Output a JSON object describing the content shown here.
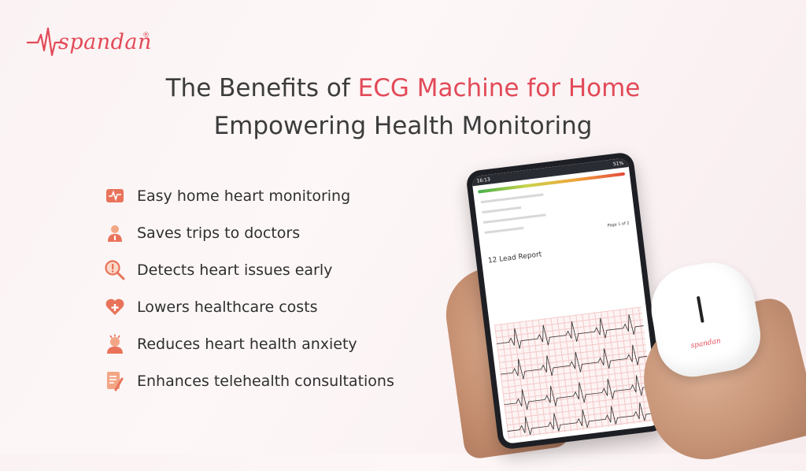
{
  "brand": {
    "name": "spandan",
    "registered": "®",
    "color": "#e24a58"
  },
  "heading": {
    "line1_prefix": "The Benefits of ",
    "line1_highlight": "ECG Machine for Home",
    "line2": "Empowering Health Monitoring"
  },
  "benefits": [
    {
      "label": "Easy home heart monitoring",
      "icon": "heart-monitor-icon"
    },
    {
      "label": "Saves trips to doctors",
      "icon": "doctor-icon"
    },
    {
      "label": "Detects heart issues early",
      "icon": "magnifier-icon"
    },
    {
      "label": "Lowers healthcare costs",
      "icon": "heart-plus-icon"
    },
    {
      "label": "Reduces heart health anxiety",
      "icon": "stress-person-icon"
    },
    {
      "label": "Enhances telehealth consultations",
      "icon": "document-pen-icon"
    }
  ],
  "phone": {
    "time": "16:13",
    "battery": "51%",
    "report_title": "12 Lead Report",
    "page_label": "Page 1 of 2"
  },
  "device": {
    "logo": "spandan"
  }
}
